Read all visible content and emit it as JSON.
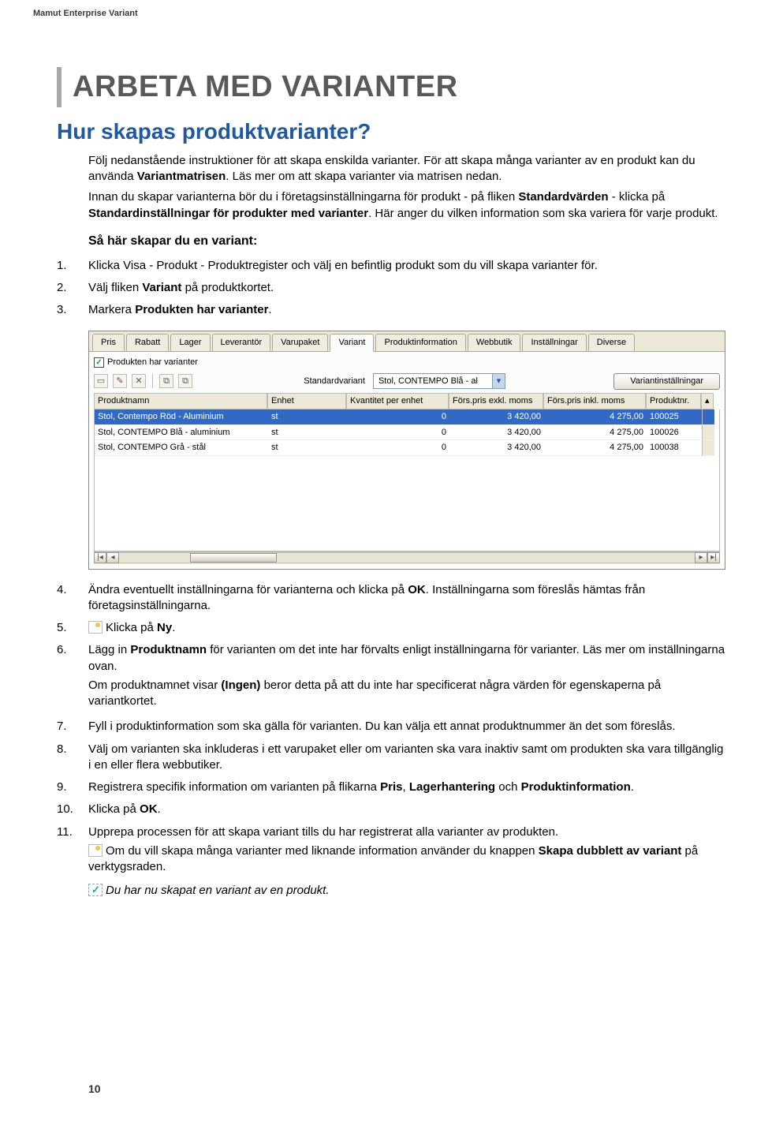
{
  "doc_header": "Mamut Enterprise Variant",
  "h1": "ARBETA MED VARIANTER",
  "h2": "Hur skapas produktvarianter?",
  "intro": {
    "p1a": "Följ nedanstående instruktioner för att skapa enskilda varianter. För att skapa många varianter av en produkt kan du använda ",
    "p1b": "Variantmatrisen",
    "p1c": ". Läs mer om att skapa varianter via matrisen nedan.",
    "p2a": "Innan du skapar varianterna bör du i företagsinställningarna för produkt - på fliken ",
    "p2b": "Standardvärden",
    "p2c": " - klicka på ",
    "p2d": "Standardinställningar för produkter med varianter",
    "p2e": ". Här anger du vilken information som ska variera för varje produkt."
  },
  "subhead": "Så här skapar du en variant:",
  "steps_a": [
    {
      "n": "1.",
      "t": "Klicka Visa - Produkt - Produktregister och välj en befintlig produkt som du vill skapa varianter för."
    },
    {
      "n": "2.",
      "t_pre": "Välj fliken ",
      "b": "Variant",
      "t_post": " på produktkortet."
    },
    {
      "n": "3.",
      "t_pre": "Markera ",
      "b": "Produkten har varianter",
      "t_post": "."
    }
  ],
  "ui": {
    "tabs": [
      "Pris",
      "Rabatt",
      "Lager",
      "Leverantör",
      "Varupaket",
      "Variant",
      "Produktinformation",
      "Webbutik",
      "Inställningar",
      "Diverse"
    ],
    "active_tab": 5,
    "checkbox_label": "Produkten har varianter",
    "std_label": "Standardvariant",
    "std_value": "Stol, CONTEMPO Blå - al",
    "vbtn": "Variantinställningar",
    "cols": [
      "Produktnamn",
      "Enhet",
      "Kvantitet per enhet",
      "Förs.pris exkl. moms",
      "Förs.pris inkl. moms",
      "Produktnr."
    ],
    "rows": [
      {
        "name": "Stol, Contempo Röd - Aluminium",
        "unit": "st",
        "qty": "0",
        "pex": "3 420,00",
        "pin": "4 275,00",
        "pno": "100025",
        "sel": true
      },
      {
        "name": "Stol, CONTEMPO Blå - aluminium",
        "unit": "st",
        "qty": "0",
        "pex": "3 420,00",
        "pin": "4 275,00",
        "pno": "100026",
        "sel": false
      },
      {
        "name": "Stol, CONTEMPO Grå - stål",
        "unit": "st",
        "qty": "0",
        "pex": "3 420,00",
        "pin": "4 275,00",
        "pno": "100038",
        "sel": false
      }
    ]
  },
  "steps_b": {
    "s4": {
      "n": "4.",
      "a": "Ändra eventuellt inställningarna för varianterna och klicka på ",
      "b": "OK",
      "c": ". Inställningarna som föreslås hämtas från företagsinställningarna."
    },
    "s5": {
      "n": "5.",
      "a": "Klicka på ",
      "b": "Ny",
      "c": "."
    },
    "s6": {
      "n": "6.",
      "a": "Lägg in ",
      "b": "Produktnamn",
      "c": " för varianten om det inte har förvalts enligt inställningarna för varianter. Läs mer om inställningarna ovan.",
      "d": "Om produktnamnet visar ",
      "e": "(Ingen)",
      "f": " beror detta på att du inte har specificerat några värden för egenskaperna på variantkortet."
    },
    "s7": {
      "n": "7.",
      "a": "Fyll i produktinformation som ska gälla för varianten. Du kan välja ett annat produktnummer än det som föreslås."
    },
    "s8": {
      "n": "8.",
      "a": "Välj om varianten ska inkluderas i ett varupaket eller om varianten ska vara inaktiv samt om produkten ska vara tillgänglig i en eller flera webbutiker."
    },
    "s9": {
      "n": "9.",
      "a": "Registrera specifik information om varianten på flikarna ",
      "b": "Pris",
      "c": ", ",
      "d": "Lagerhantering",
      "e": " och ",
      "f": "Produktinformation",
      "g": "."
    },
    "s10": {
      "n": "10.",
      "a": "Klicka på ",
      "b": "OK",
      "c": "."
    },
    "s11": {
      "n": "11.",
      "a": "Upprepa processen för att skapa variant tills du har registrerat alla varianter av produkten.",
      "b": "Om du vill skapa många varianter med liknande information använder du knappen ",
      "c": "Skapa dubblett av variant",
      "d": " på verktygsraden."
    }
  },
  "done": "Du har nu skapat en variant av en produkt.",
  "page_number": "10"
}
